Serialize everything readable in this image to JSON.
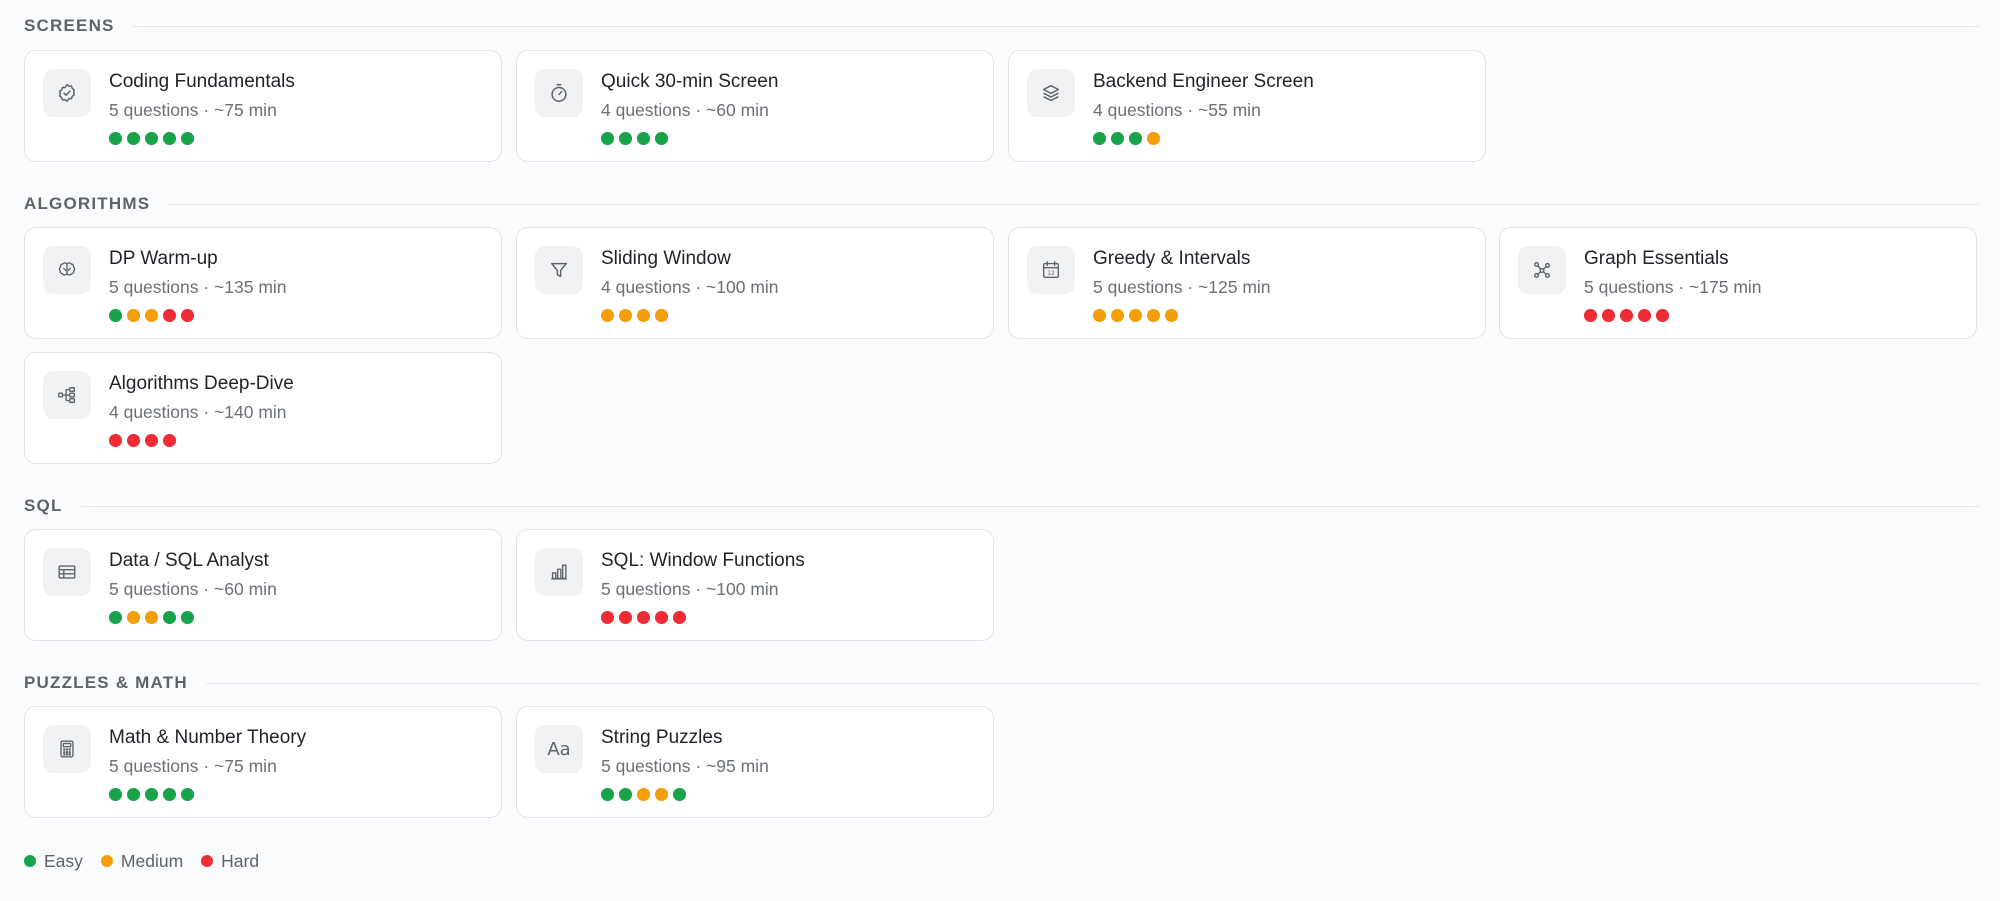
{
  "colors": {
    "easy": "#16a34a",
    "medium": "#f59e0b",
    "hard": "#ef2b36"
  },
  "sections": [
    {
      "title": "SCREENS",
      "cards": [
        {
          "title": "Coding Fundamentals",
          "meta": "5 questions · ~75 min",
          "icon": "badge-check-icon",
          "dots": [
            "easy",
            "easy",
            "easy",
            "easy",
            "easy"
          ]
        },
        {
          "title": "Quick 30-min Screen",
          "meta": "4 questions · ~60 min",
          "icon": "stopwatch-icon",
          "dots": [
            "easy",
            "easy",
            "easy",
            "easy"
          ]
        },
        {
          "title": "Backend Engineer Screen",
          "meta": "4 questions · ~55 min",
          "icon": "layers-icon",
          "dots": [
            "easy",
            "easy",
            "easy",
            "medium"
          ]
        }
      ]
    },
    {
      "title": "ALGORITHMS",
      "cards": [
        {
          "title": "DP Warm-up",
          "meta": "5 questions · ~135 min",
          "icon": "brain-icon",
          "dots": [
            "easy",
            "medium",
            "medium",
            "hard",
            "hard"
          ]
        },
        {
          "title": "Sliding Window",
          "meta": "4 questions · ~100 min",
          "icon": "filter-icon",
          "dots": [
            "medium",
            "medium",
            "medium",
            "medium"
          ]
        },
        {
          "title": "Greedy & Intervals",
          "meta": "5 questions · ~125 min",
          "icon": "calendar-icon",
          "dots": [
            "medium",
            "medium",
            "medium",
            "medium",
            "medium"
          ]
        },
        {
          "title": "Graph Essentials",
          "meta": "5 questions · ~175 min",
          "icon": "graph-nodes-icon",
          "dots": [
            "hard",
            "hard",
            "hard",
            "hard",
            "hard"
          ]
        },
        {
          "title": "Algorithms Deep-Dive",
          "meta": "4 questions · ~140 min",
          "icon": "tree-structure-icon",
          "dots": [
            "hard",
            "hard",
            "hard",
            "hard"
          ]
        }
      ]
    },
    {
      "title": "SQL",
      "cards": [
        {
          "title": "Data / SQL Analyst",
          "meta": "5 questions · ~60 min",
          "icon": "table-icon",
          "dots": [
            "easy",
            "medium",
            "medium",
            "easy",
            "easy"
          ]
        },
        {
          "title": "SQL: Window Functions",
          "meta": "5 questions · ~100 min",
          "icon": "bar-chart-icon",
          "dots": [
            "hard",
            "hard",
            "hard",
            "hard",
            "hard"
          ]
        }
      ]
    },
    {
      "title": "PUZZLES & MATH",
      "cards": [
        {
          "title": "Math & Number Theory",
          "meta": "5 questions · ~75 min",
          "icon": "calculator-icon",
          "dots": [
            "easy",
            "easy",
            "easy",
            "easy",
            "easy"
          ]
        },
        {
          "title": "String Puzzles",
          "meta": "5 questions · ~95 min",
          "icon": "text-aa-icon",
          "icon_text": "Aa",
          "dots": [
            "easy",
            "easy",
            "medium",
            "medium",
            "easy"
          ]
        }
      ]
    }
  ],
  "legend": [
    {
      "key": "easy",
      "label": "Easy"
    },
    {
      "key": "medium",
      "label": "Medium"
    },
    {
      "key": "hard",
      "label": "Hard"
    }
  ]
}
